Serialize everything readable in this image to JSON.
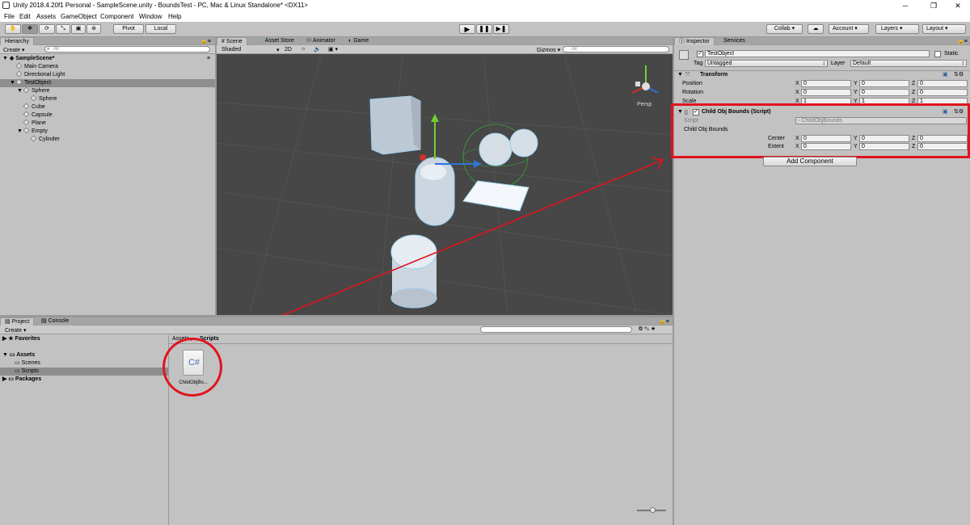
{
  "window": {
    "title": "Unity 2018.4.20f1 Personal - SampleScene.unity - BoundsTest - PC, Mac & Linux Standalone* <DX11>",
    "min": "─",
    "restore": "❐",
    "close": "✕"
  },
  "menu": [
    "File",
    "Edit",
    "Assets",
    "GameObject",
    "Component",
    "Window",
    "Help"
  ],
  "toolbar": {
    "pivot": "Pivot",
    "local": "Local",
    "collab": "Collab ▾",
    "account": "Account",
    "layers": "Layers",
    "layout": "Layout"
  },
  "hierarchy": {
    "tab": "Hierarchy",
    "create": "Create",
    "search_placeholder": "All",
    "scene": "SampleScene*",
    "items": [
      {
        "label": "Main Camera",
        "indent": 2,
        "expanded": null,
        "selected": false
      },
      {
        "label": "Directional Light",
        "indent": 2,
        "expanded": null,
        "selected": false
      },
      {
        "label": "TestObject",
        "indent": 2,
        "expanded": true,
        "selected": true
      },
      {
        "label": "Sphere",
        "indent": 3,
        "expanded": true,
        "selected": false
      },
      {
        "label": "Sphere",
        "indent": 4,
        "expanded": null,
        "selected": false
      },
      {
        "label": "Cube",
        "indent": 3,
        "expanded": null,
        "selected": false
      },
      {
        "label": "Capsule",
        "indent": 3,
        "expanded": null,
        "selected": false
      },
      {
        "label": "Plane",
        "indent": 3,
        "expanded": null,
        "selected": false
      },
      {
        "label": "Empty",
        "indent": 3,
        "expanded": true,
        "selected": false
      },
      {
        "label": "Cylinder",
        "indent": 4,
        "expanded": null,
        "selected": false
      }
    ]
  },
  "scene": {
    "tabs": [
      "Scene",
      "Asset Store",
      "Animator",
      "Game"
    ],
    "shading": "Shaded",
    "mode2d": "2D",
    "gizmos": "Gizmos",
    "search_placeholder": "All",
    "persp": "Persp"
  },
  "inspector": {
    "tabs": [
      "Inspector",
      "Services"
    ],
    "object_name": "TestObject",
    "static_label": "Static",
    "tag_label": "Tag",
    "tag_value": "Untagged",
    "layer_label": "Layer",
    "layer_value": "Default",
    "transform": {
      "title": "Transform",
      "rows": [
        {
          "label": "Position",
          "x": "0",
          "y": "0",
          "z": "0"
        },
        {
          "label": "Rotation",
          "x": "0",
          "y": "0",
          "z": "0"
        },
        {
          "label": "Scale",
          "x": "1",
          "y": "1",
          "z": "1"
        }
      ]
    },
    "script_component": {
      "title": "Child Obj Bounds (Script)",
      "script_label": "Script",
      "script_value": "ChildObjBounds",
      "section": "Child Obj Bounds",
      "rows": [
        {
          "label": "Center",
          "x": "0",
          "y": "0",
          "z": "0"
        },
        {
          "label": "Extent",
          "x": "0",
          "y": "0",
          "z": "0"
        }
      ]
    },
    "add_component": "Add Component"
  },
  "project": {
    "tabs": [
      "Project",
      "Console"
    ],
    "create": "Create",
    "tree": {
      "favorites": "Favorites",
      "assets": "Assets",
      "scenes": "Scenes",
      "scripts": "Scripts",
      "packages": "Packages"
    },
    "breadcrumb": [
      "Assets",
      "Scripts"
    ],
    "file": {
      "icon_text": "C#",
      "name": "ChildObjBo..."
    }
  },
  "axis_labels": {
    "x": "X",
    "y": "Y",
    "z": "Z"
  },
  "colors": {
    "highlight": "#e0141e",
    "scene_bg": "#474747",
    "selection": "#8e8e8e"
  }
}
